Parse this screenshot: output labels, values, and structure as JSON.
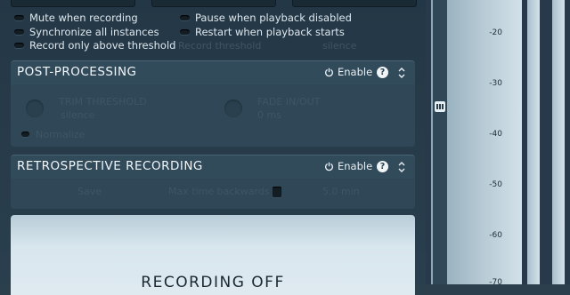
{
  "recording_options": {
    "left": [
      "Mute when recording",
      "Synchronize all instances",
      "Record only above threshold"
    ],
    "right": [
      "Pause when playback disabled",
      "Restart when playback starts"
    ],
    "threshold_row": {
      "label": "Record threshold",
      "value": "silence"
    }
  },
  "post_processing": {
    "title": "POST-PROCESSING",
    "enable_label": "Enable",
    "help": "?",
    "trim_label": "TRIM THRESHOLD",
    "trim_value": "silence",
    "fade_label": "FADE IN/OUT",
    "fade_value": "0 ms",
    "normalize_label": "Normalize"
  },
  "retrospective": {
    "title": "RETROSPECTIVE RECORDING",
    "enable_label": "Enable",
    "help": "?",
    "save_label": "Save",
    "max_time_label": "Max time backwards",
    "max_time_value": "5.0 min"
  },
  "status": {
    "text": "RECORDING OFF"
  },
  "meter": {
    "ticks": [
      "-20",
      "-30",
      "-40",
      "-50",
      "-60",
      "-70"
    ]
  }
}
